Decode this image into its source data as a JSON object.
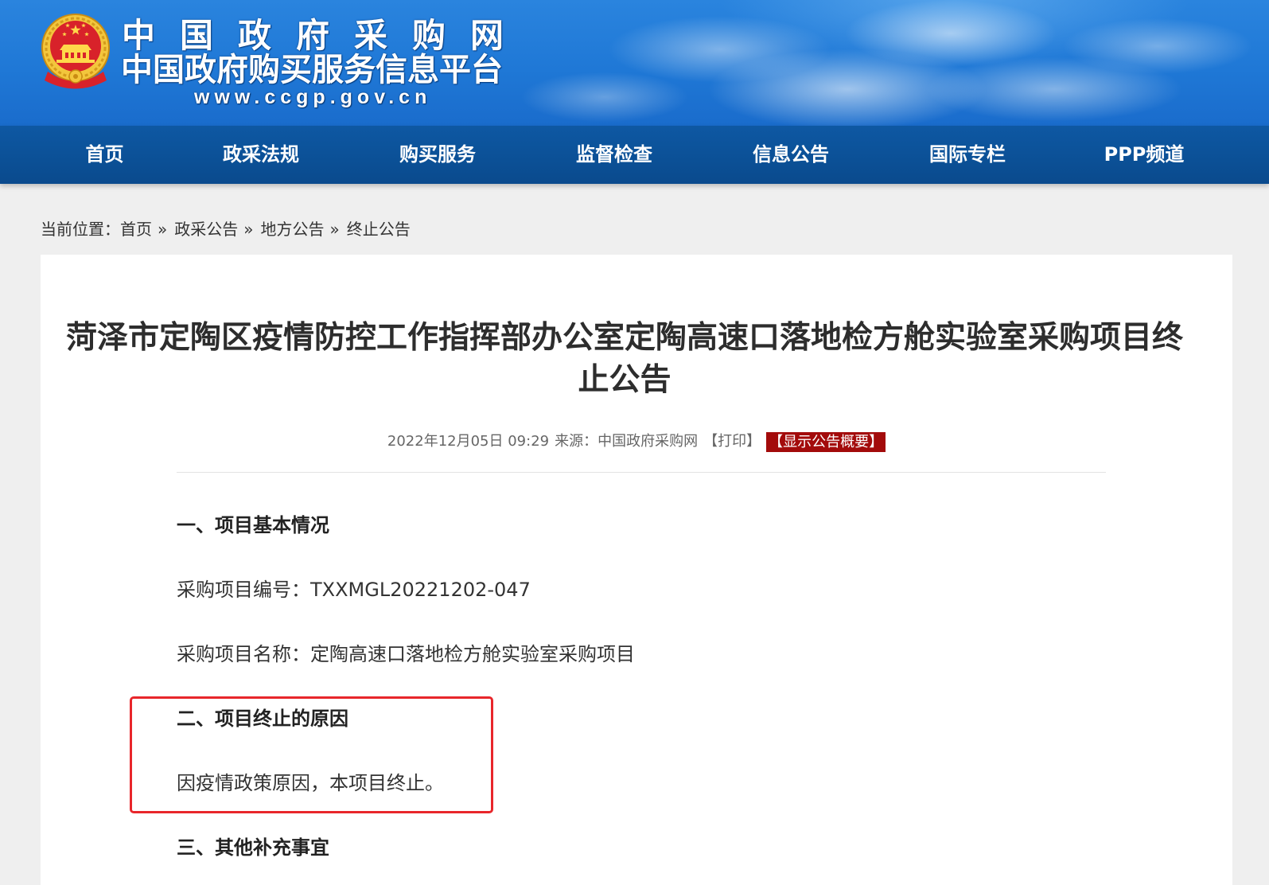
{
  "site": {
    "title": "中国政府采购网",
    "subtitle": "中国政府购买服务信息平台",
    "url": "www.ccgp.gov.cn",
    "emblem_icon": "national-emblem-icon"
  },
  "nav": {
    "items": [
      {
        "label": "首页"
      },
      {
        "label": "政采法规"
      },
      {
        "label": "购买服务"
      },
      {
        "label": "监督检查"
      },
      {
        "label": "信息公告"
      },
      {
        "label": "国际专栏"
      },
      {
        "label": "PPP频道"
      }
    ]
  },
  "breadcrumb": {
    "prefix": "当前位置：",
    "separator": "»",
    "items": [
      "首页",
      "政采公告",
      "地方公告",
      "终止公告"
    ]
  },
  "article": {
    "title": "菏泽市定陶区疫情防控工作指挥部办公室定陶高速口落地检方舱实验室采购项目终止公告",
    "date": "2022年12月05日 09:29",
    "source_label": "来源：",
    "source": "中国政府采购网",
    "print_label": "【打印】",
    "summary_label": "【显示公告概要】",
    "body": [
      "一、项目基本情况",
      "采购项目编号：TXXMGL20221202-047",
      "采购项目名称：定陶高速口落地检方舱实验室采购项目",
      "二、项目终止的原因",
      "因疫情政策原因，本项目终止。",
      "三、其他补充事宜"
    ]
  },
  "colors": {
    "header_blue": "#1f78d6",
    "nav_bg": "#0b5096",
    "page_bg": "#efefef",
    "summary_badge_bg": "#a30b0b",
    "highlight_border": "#e8262b"
  }
}
